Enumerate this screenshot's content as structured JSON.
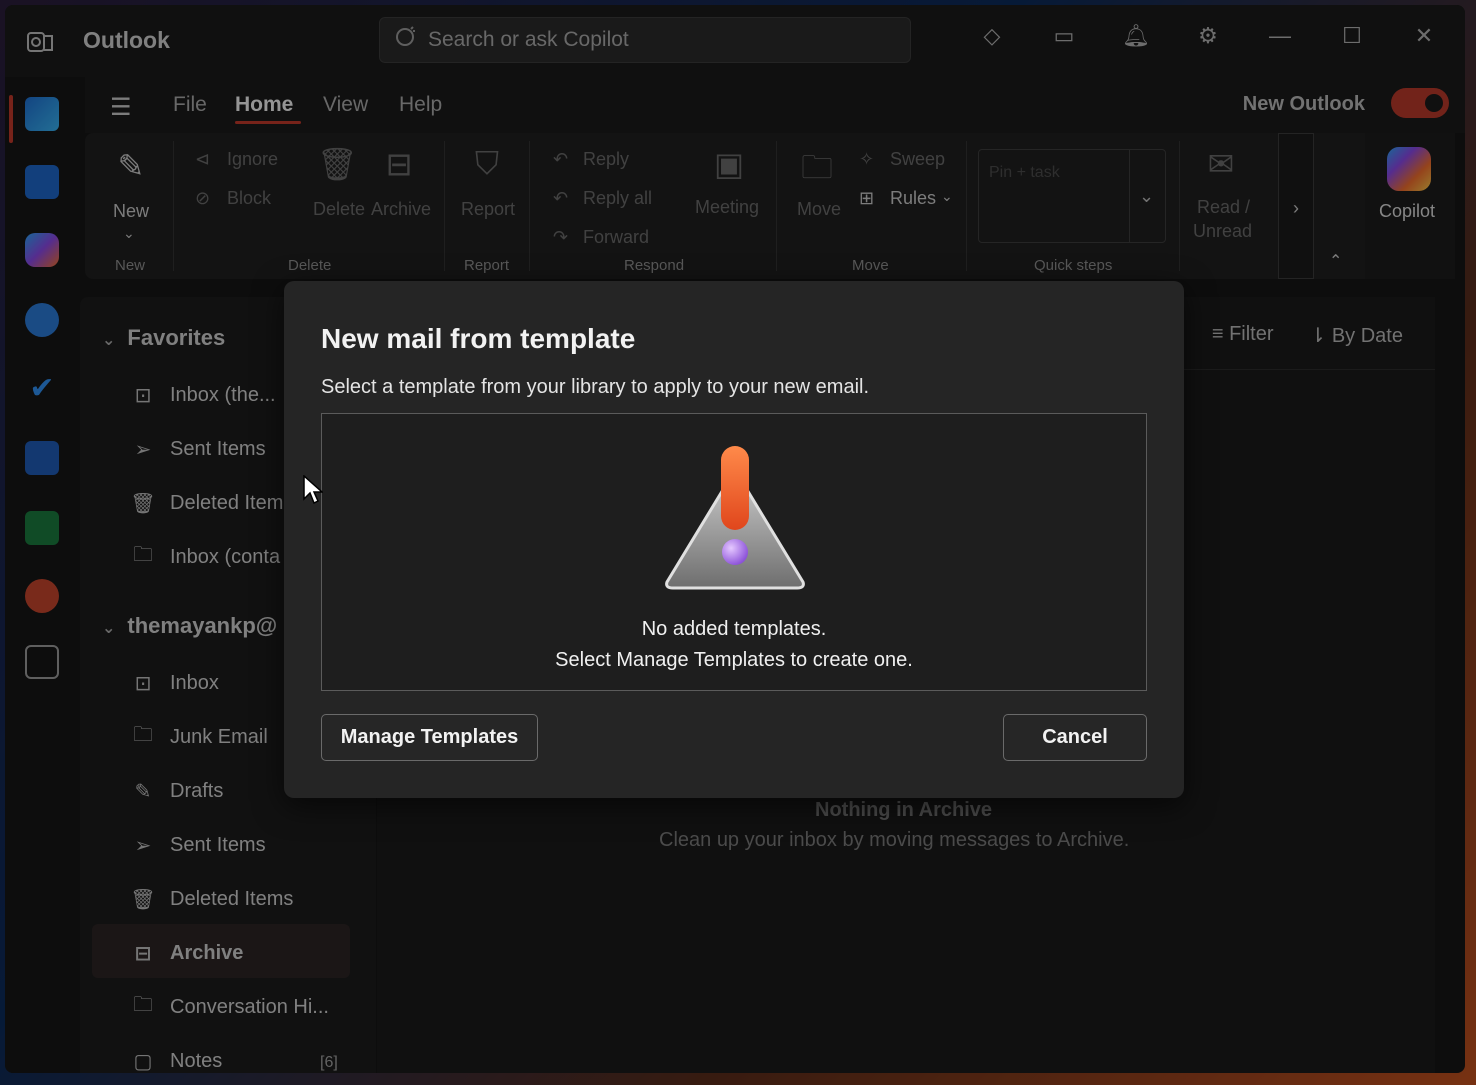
{
  "app": {
    "title": "Outlook",
    "search_placeholder": "Search or ask Copilot",
    "new_outlook_label": "New Outlook"
  },
  "menu": {
    "tabs": [
      "File",
      "Home",
      "View",
      "Help"
    ],
    "active_tab": "Home"
  },
  "ribbon": {
    "new_label": "New",
    "ignore": "Ignore",
    "block": "Block",
    "delete": "Delete",
    "archive": "Archive",
    "report": "Report",
    "reply": "Reply",
    "reply_all": "Reply all",
    "forward": "Forward",
    "meeting": "Meeting",
    "move": "Move",
    "sweep": "Sweep",
    "rules": "Rules",
    "pin_task": "Pin + task",
    "read_unread_1": "Read /",
    "read_unread_2": "Unread",
    "copilot": "Copilot",
    "groups": {
      "new": "New",
      "delete": "Delete",
      "report": "Report",
      "respond": "Respond",
      "move": "Move",
      "quick_steps": "Quick steps"
    }
  },
  "folders": {
    "favorites_header": "Favorites",
    "favorites": [
      {
        "label": "Inbox (the..."
      },
      {
        "label": "Sent Items"
      },
      {
        "label": "Deleted Item"
      },
      {
        "label": "Inbox (conta"
      }
    ],
    "account_header": "themayankp@",
    "account": [
      {
        "label": "Inbox"
      },
      {
        "label": "Junk Email"
      },
      {
        "label": "Drafts"
      },
      {
        "label": "Sent Items"
      },
      {
        "label": "Deleted Items"
      },
      {
        "label": "Archive"
      },
      {
        "label": "Conversation Hi..."
      },
      {
        "label": "Notes"
      }
    ],
    "notes_count": "[6]",
    "selected": "Archive"
  },
  "message_list": {
    "filter": "Filter",
    "sort": "By Date",
    "empty_title": "Nothing in Archive",
    "empty_subtitle": "Clean up your inbox by moving messages to Archive."
  },
  "dialog": {
    "title": "New mail from template",
    "subtitle": "Select a template from your library to apply to your new email.",
    "empty_line1": "No added templates.",
    "empty_line2": "Select Manage Templates to create one.",
    "manage_button": "Manage Templates",
    "cancel_button": "Cancel"
  },
  "colors": {
    "accent": "#c0392b",
    "window_bg": "#161616",
    "dialog_bg": "#252525"
  }
}
